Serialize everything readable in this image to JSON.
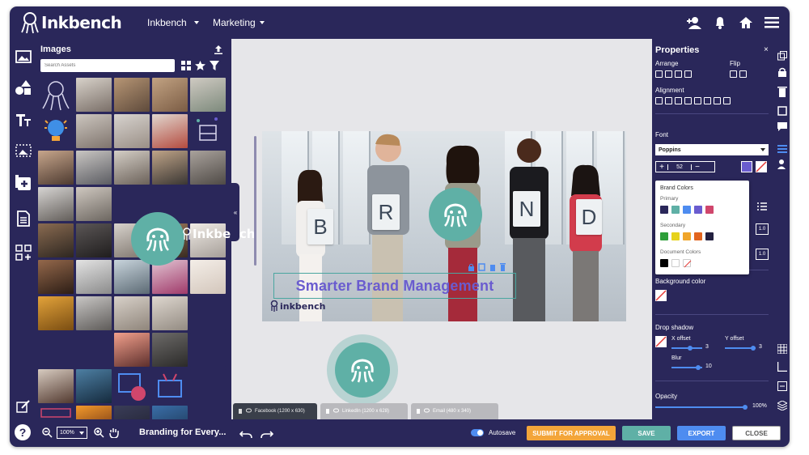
{
  "app": {
    "brand": "Inkbench",
    "nav": [
      "Inkbench",
      "Marketing"
    ]
  },
  "assets": {
    "title": "Images",
    "search_placeholder": "Search Assets",
    "logo_wordmark": "Inkbench"
  },
  "canvas": {
    "letters": [
      "B",
      "R",
      "N",
      "D"
    ],
    "headline": "Smarter Brand Management",
    "logo_wordmark": "inkbench"
  },
  "size_tabs": [
    "Facebook (1200 x 630)",
    "LinkedIn (1200 x 628)",
    "Email (480 x 340)"
  ],
  "properties": {
    "title": "Properties",
    "arrange": "Arrange",
    "flip": "Flip",
    "alignment": "Alignment",
    "font": "Font",
    "font_family": "Poppins",
    "font_size": "52",
    "line_height": "1.0",
    "letter_spacing": "1.0",
    "background_color": "Background color",
    "drop_shadow": "Drop shadow",
    "x_offset": "X offset",
    "y_offset": "Y offset",
    "x_offset_value": "3",
    "y_offset_value": "3",
    "blur": "Blur",
    "blur_value": "10",
    "opacity": "Opacity",
    "opacity_value": "100%",
    "opacity_fraction": 1.0
  },
  "color_popup": {
    "title": "Brand Colors",
    "primary": "Primary",
    "secondary": "Secondary",
    "document": "Document Colors",
    "primary_colors": [
      "#2a275a",
      "#5fb0a6",
      "#4e8cf0",
      "#6a5ccf",
      "#d0466c"
    ],
    "secondary_colors": [
      "#2e9e3a",
      "#e6d21c",
      "#f0a52a",
      "#e2651f",
      "#232040"
    ],
    "document_colors": [
      "#000000",
      "#ffffff"
    ]
  },
  "bottom": {
    "zoom": "100%",
    "doc_title": "Branding for Every...",
    "autosave": "Autosave",
    "submit": "SUBMIT FOR APPROVAL",
    "save": "SAVE",
    "export": "EXPORT",
    "close": "CLOSE"
  },
  "colors": {
    "navy": "#2a275a",
    "teal": "#5fb0a6",
    "purple": "#6a5ccf",
    "blue": "#4e8cf0",
    "orange": "#f3a53a"
  }
}
